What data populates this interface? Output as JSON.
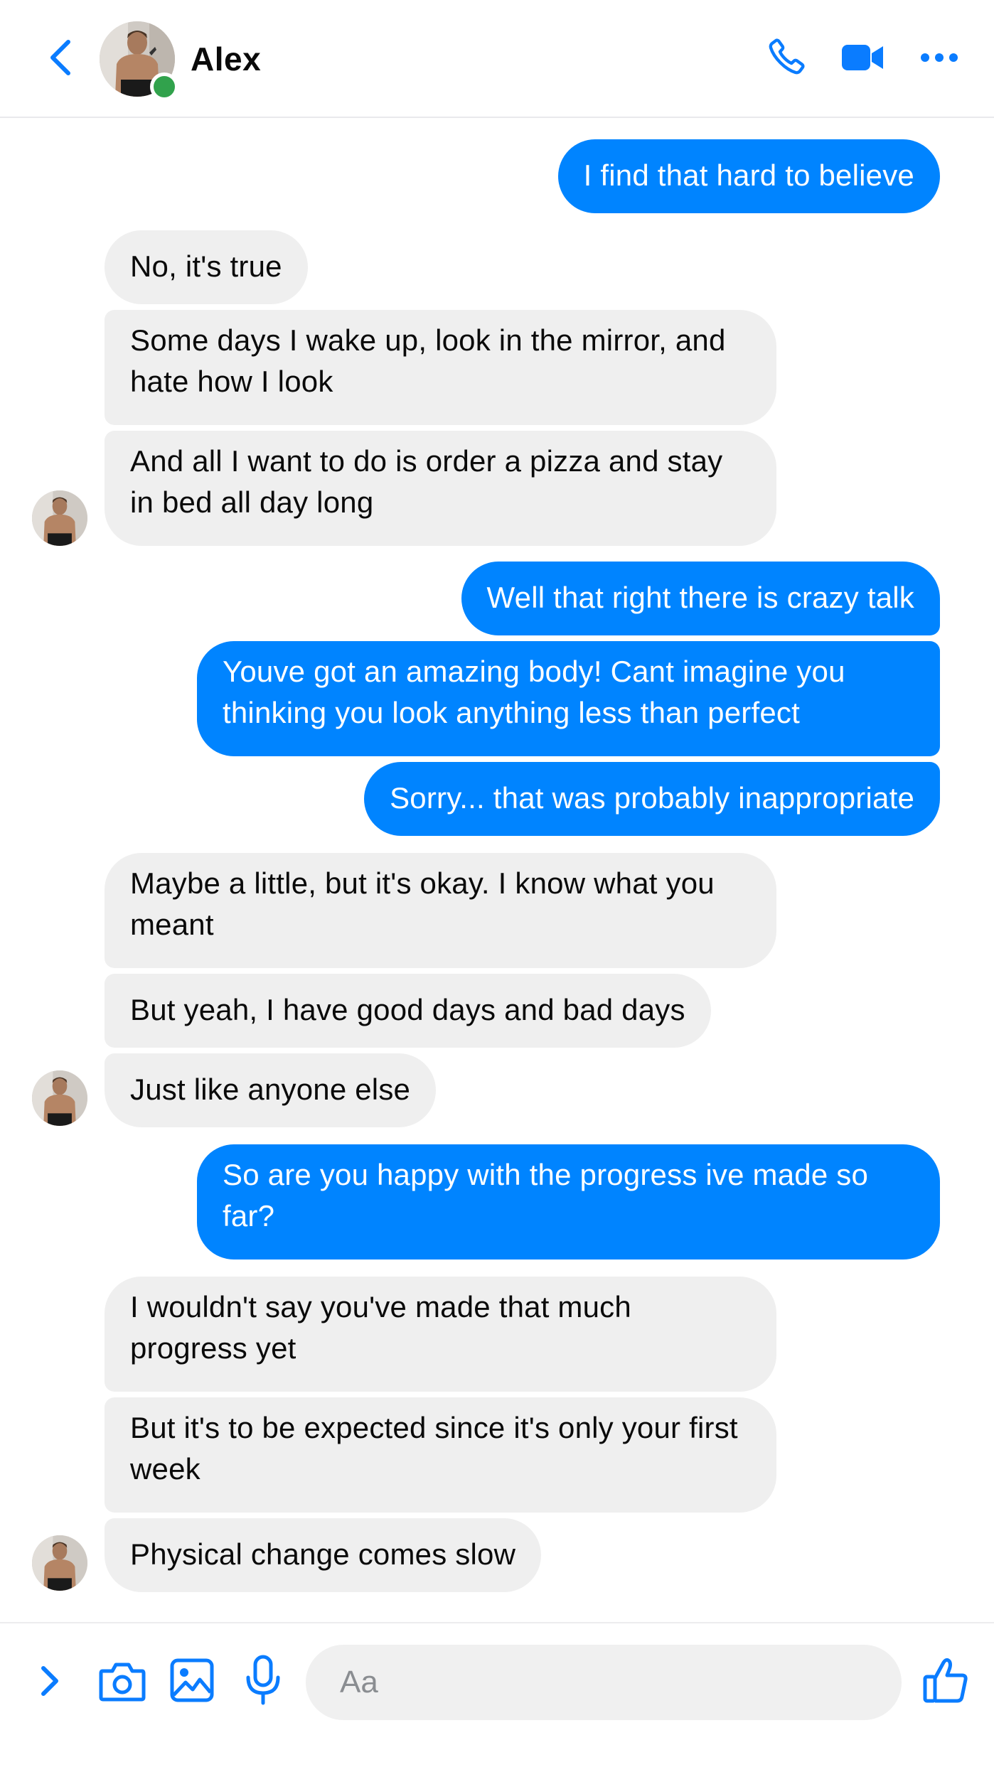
{
  "header": {
    "contact_name": "Alex",
    "online": true
  },
  "colors": {
    "accent": "#0084ff",
    "incoming_bubble": "#efefef",
    "online_dot": "#31a24c",
    "icon_blue": "#0a7cff"
  },
  "icons": {
    "back": "chevron-left-icon",
    "call": "phone-icon",
    "video": "video-camera-icon",
    "more": "more-dots-icon",
    "expand": "chevron-right-icon",
    "camera": "camera-icon",
    "gallery": "image-icon",
    "voice": "microphone-icon",
    "like": "thumbs-up-icon"
  },
  "messages": [
    {
      "from": "me",
      "text": "I find that hard to believe"
    },
    {
      "from": "Alex",
      "text": "No, it's true"
    },
    {
      "from": "Alex",
      "text": "Some days I wake up, look in the mirror, and hate how I look"
    },
    {
      "from": "Alex",
      "text": "And all I want to do is order a pizza and stay in bed all day long"
    },
    {
      "from": "me",
      "text": "Well that right there is crazy talk"
    },
    {
      "from": "me",
      "text": "Youve got an amazing body! Cant imagine you thinking you look anything less than perfect"
    },
    {
      "from": "me",
      "text": "Sorry... that was probably inappropriate"
    },
    {
      "from": "Alex",
      "text": "Maybe a little, but it's okay. I know what you meant"
    },
    {
      "from": "Alex",
      "text": "But yeah, I have good days and bad days"
    },
    {
      "from": "Alex",
      "text": "Just like anyone else"
    },
    {
      "from": "me",
      "text": "So are you happy with the progress ive made so far?"
    },
    {
      "from": "Alex",
      "text": "I wouldn't say you've made that much progress yet"
    },
    {
      "from": "Alex",
      "text": "But it's to be expected since it's only your first week"
    },
    {
      "from": "Alex",
      "text": "Physical change comes slow"
    }
  ],
  "composer": {
    "placeholder": "Aa"
  }
}
